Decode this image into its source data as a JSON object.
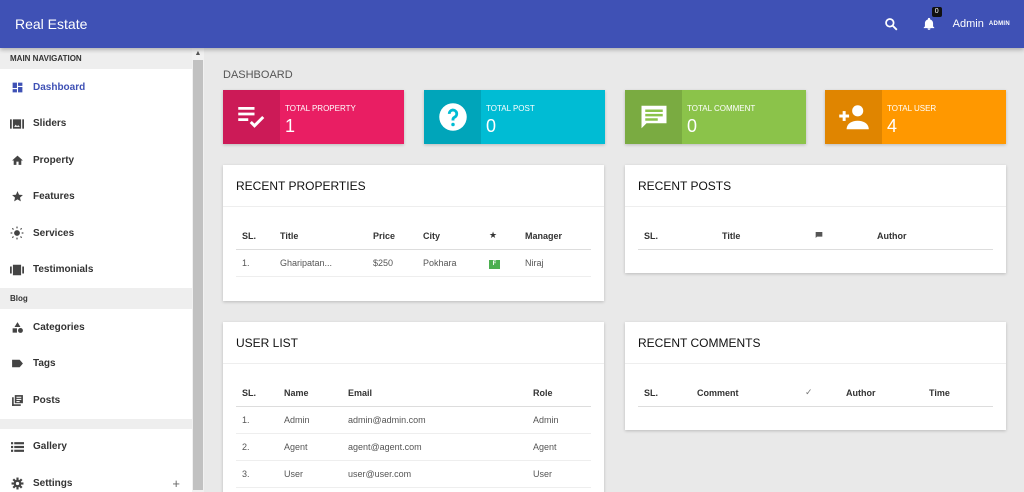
{
  "app": {
    "title": "Real Estate"
  },
  "header": {
    "notification_count": "0",
    "user_name": "Admin",
    "user_role": "ADMIN"
  },
  "sidebar": {
    "main_header": "MAIN NAVIGATION",
    "main_items": [
      {
        "label": "Dashboard",
        "icon": "dashboard-icon"
      },
      {
        "label": "Sliders",
        "icon": "slider-icon"
      },
      {
        "label": "Property",
        "icon": "home-icon"
      },
      {
        "label": "Features",
        "icon": "star-icon"
      },
      {
        "label": "Services",
        "icon": "sun-icon"
      },
      {
        "label": "Testimonials",
        "icon": "carousel-icon"
      }
    ],
    "blog_header": "Blog",
    "blog_items": [
      {
        "label": "Categories",
        "icon": "category-icon"
      },
      {
        "label": "Tags",
        "icon": "tag-icon"
      },
      {
        "label": "Posts",
        "icon": "posts-icon"
      }
    ],
    "other_items": [
      {
        "label": "Gallery",
        "icon": "gallery-icon"
      },
      {
        "label": "Settings",
        "icon": "gear-icon",
        "expand": "+"
      }
    ]
  },
  "page": {
    "heading": "DASHBOARD"
  },
  "stats": [
    {
      "label": "TOTAL PROPERTY",
      "value": "1",
      "color": "#e91e63",
      "icon": "playlist-check-icon"
    },
    {
      "label": "TOTAL POST",
      "value": "0",
      "color": "#00bcd4",
      "icon": "help-icon"
    },
    {
      "label": "TOTAL COMMENT",
      "value": "0",
      "color": "#8bc34a",
      "icon": "comment-icon"
    },
    {
      "label": "TOTAL USER",
      "value": "4",
      "color": "#ff9800",
      "icon": "person-add-icon"
    }
  ],
  "recent_properties": {
    "title": "RECENT PROPERTIES",
    "columns": [
      "SL.",
      "Title",
      "Price",
      "City",
      "★",
      "Manager"
    ],
    "rows": [
      {
        "sl": "1.",
        "title": "Gharipatan...",
        "price": "$250",
        "city": "Pokhara",
        "badge": "F",
        "manager": "Niraj"
      }
    ]
  },
  "recent_posts": {
    "title": "RECENT POSTS",
    "columns": [
      "SL.",
      "Title",
      "comment-icon",
      "Author"
    ]
  },
  "user_list": {
    "title": "USER LIST",
    "columns": [
      "SL.",
      "Name",
      "Email",
      "Role"
    ],
    "rows": [
      {
        "sl": "1.",
        "name": "Admin",
        "email": "admin@admin.com",
        "role": "Admin"
      },
      {
        "sl": "2.",
        "name": "Agent",
        "email": "agent@agent.com",
        "role": "Agent"
      },
      {
        "sl": "3.",
        "name": "User",
        "email": "user@user.com",
        "role": "User"
      }
    ]
  },
  "recent_comments": {
    "title": "RECENT COMMENTS",
    "columns": [
      "SL.",
      "Comment",
      "✓",
      "Author",
      "Time"
    ]
  },
  "colors": {
    "primary": "#3f51b5",
    "active_nav": "#3f51b5",
    "badge_green": "#4caf50"
  }
}
